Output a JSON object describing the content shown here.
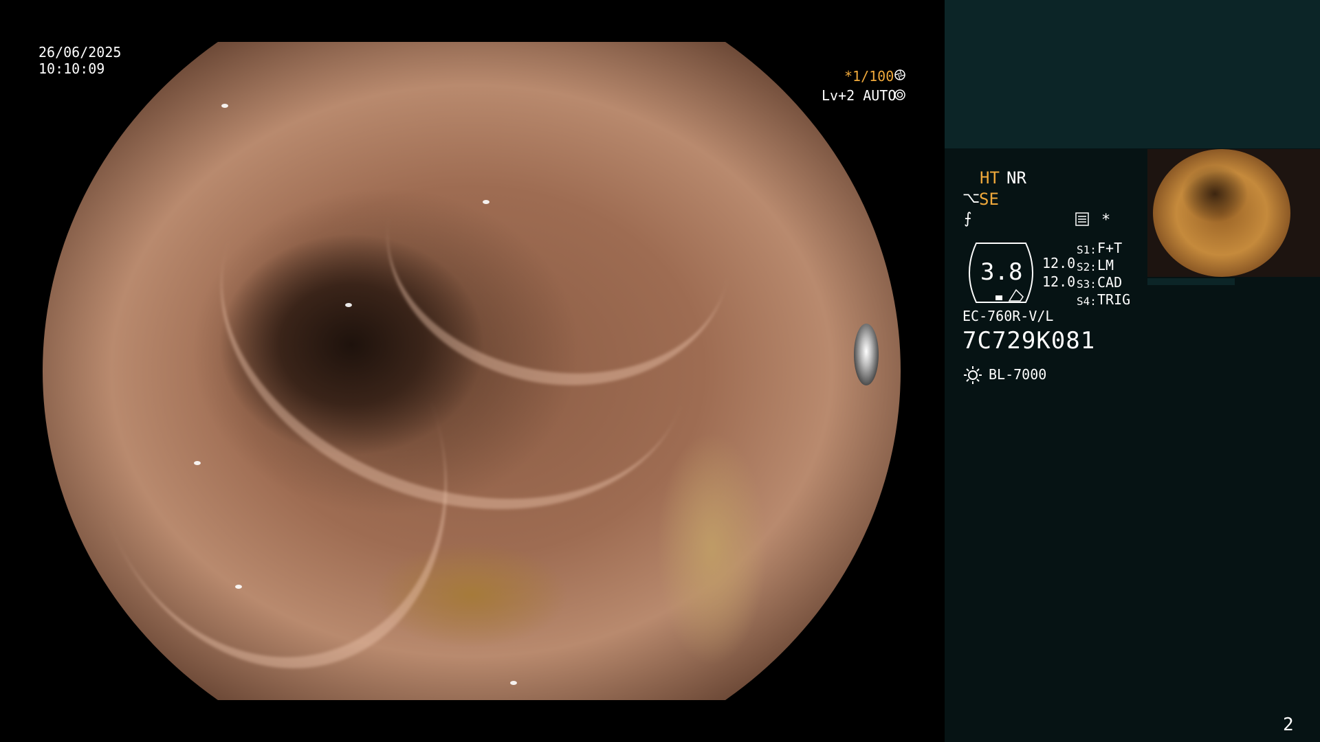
{
  "overlay": {
    "date": "26/06/2025",
    "time": "10:10:09",
    "magnification": "*1/100",
    "magnification_icon": "aperture-icon",
    "enhancement": "Lv+2 AUTO",
    "enhancement_icon": "iris-icon"
  },
  "panel": {
    "ht": "HT",
    "nr": "NR",
    "se": "SE",
    "se_icon": "scope-tip-icon",
    "curve_icon": "curve-icon",
    "memo_icon": "memo-icon",
    "asterisk": "*",
    "gauge_value": "3.8",
    "value_a": "12.0",
    "value_b": "12.0",
    "modes": [
      {
        "tag": "S1:",
        "value": "F+T"
      },
      {
        "tag": "S2:",
        "value": "LM"
      },
      {
        "tag": "S3:",
        "value": "CAD"
      },
      {
        "tag": "S4:",
        "value": "TRIG"
      }
    ],
    "scope_model": "EC-760R-V/L",
    "scope_serial": "7C729K081",
    "light_icon": "sun-icon",
    "light_source": "BL-7000"
  },
  "page_number": "2",
  "colors": {
    "accent_orange": "#f0a93b",
    "panel_bg": "#061314",
    "panel_top_bg": "#0c2527"
  }
}
